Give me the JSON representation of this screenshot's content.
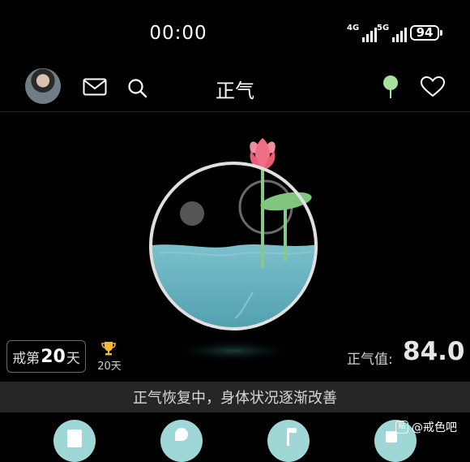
{
  "status_bar": {
    "time": "00:00",
    "network_1": "4G",
    "network_2": "5G",
    "battery": "94"
  },
  "header": {
    "title": "正气",
    "icons": [
      "avatar",
      "mail-icon",
      "search-icon",
      "tree-icon",
      "heart-icon"
    ]
  },
  "streak": {
    "prefix": "戒第",
    "days": "20",
    "suffix": "天",
    "trophy_label": "20天"
  },
  "zhengqi": {
    "label": "正气值:",
    "value": "84.0"
  },
  "status_message": "正气恢复中，身体状况逐渐改善",
  "watermark": "@戒色吧",
  "colors": {
    "water": "#6fb3bf",
    "lotus_pink": "#ef6f86",
    "leaf_green": "#7fc77f",
    "tree_green": "#a8e0a0",
    "tab_accent": "#9ed7d6"
  }
}
